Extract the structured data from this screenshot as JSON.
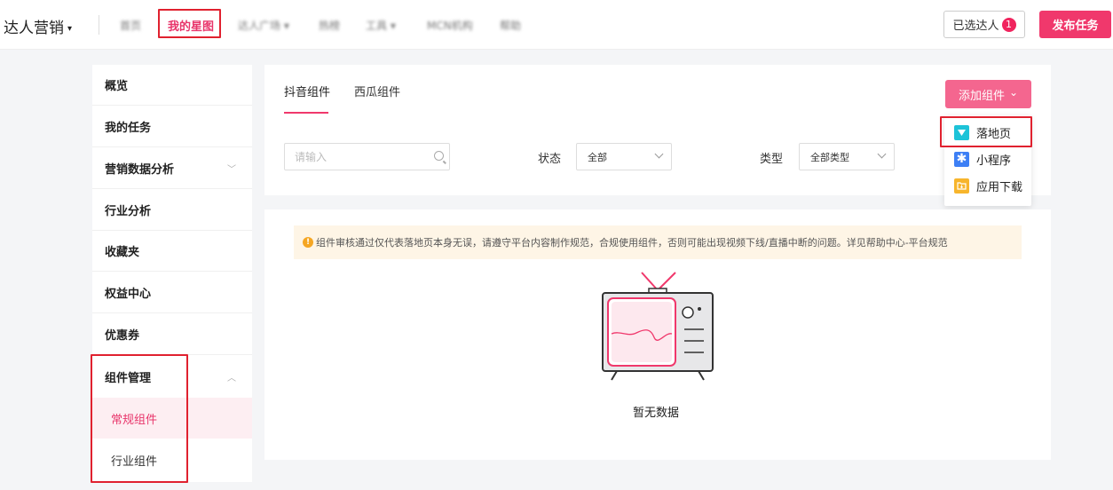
{
  "header": {
    "brand": "达人营销",
    "brand_caret": "▾",
    "nav_blurred": [
      "首页",
      "达人广场 ▾",
      "热榜",
      "工具 ▾",
      "MCN机构",
      "帮助"
    ],
    "nav_active": "我的星图",
    "selected_label": "已选达人",
    "selected_count": "1",
    "publish_label": "发布任务"
  },
  "sidebar": {
    "items": [
      {
        "label": "概览"
      },
      {
        "label": "我的任务"
      },
      {
        "label": "营销数据分析",
        "chev": "﹀"
      },
      {
        "label": "行业分析"
      },
      {
        "label": "收藏夹"
      },
      {
        "label": "权益中心"
      },
      {
        "label": "优惠券"
      },
      {
        "label": "组件管理",
        "chev": "︿"
      }
    ],
    "sub_items": [
      {
        "label": "常规组件",
        "active": true
      },
      {
        "label": "行业组件",
        "active": false
      }
    ]
  },
  "filters": {
    "tabs": [
      "抖音组件",
      "西瓜组件"
    ],
    "add_button": "添加组件",
    "add_caret": "⌄",
    "search_placeholder": "请输入",
    "status_label": "状态",
    "status_value": "全部",
    "type_label": "类型",
    "type_value": "全部类型"
  },
  "dropdown": {
    "items": [
      {
        "label": "落地页",
        "icon": "landing-page-icon",
        "color": "#1dc3d8"
      },
      {
        "label": "小程序",
        "icon": "mini-program-icon",
        "color": "#3d7ff5"
      },
      {
        "label": "应用下载",
        "icon": "app-download-icon",
        "color": "#f7b52c"
      }
    ]
  },
  "content": {
    "notice": "组件审核通过仅代表落地页本身无误，请遵守平台内容制作规范，合规使用组件，否则可能出现视频下线/直播中断的问题。详见帮助中心-平台规范",
    "empty": "暂无数据"
  },
  "colors": {
    "accent": "#f0386c",
    "highlight": "#e0212f"
  }
}
